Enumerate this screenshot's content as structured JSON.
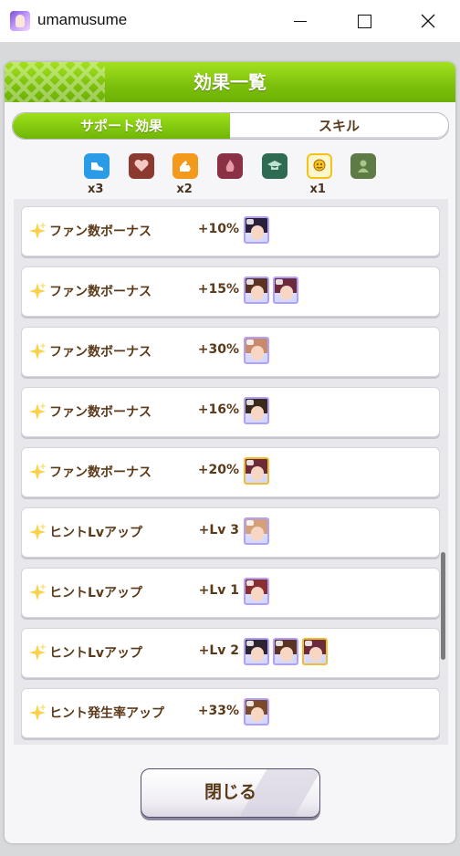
{
  "window": {
    "title": "umamusume",
    "minimize_icon": "minimize-icon",
    "maximize_icon": "maximize-icon",
    "close_icon": "close-icon"
  },
  "dialog": {
    "title": "効果一覧",
    "tabs": [
      {
        "label": "サポート効果",
        "active": true
      },
      {
        "label": "スキル",
        "active": false
      }
    ],
    "type_icons": [
      {
        "icon": "speed-shoe-icon",
        "color": "#2a9be6",
        "count": "x3"
      },
      {
        "icon": "stamina-heart-icon",
        "color": "#8c3a2f",
        "count": ""
      },
      {
        "icon": "power-arm-icon",
        "color": "#f39a1c",
        "count": "x2"
      },
      {
        "icon": "guts-flame-icon",
        "color": "#8a3146",
        "count": ""
      },
      {
        "icon": "wisdom-cap-icon",
        "color": "#2f6b52",
        "count": ""
      },
      {
        "icon": "friend-smile-icon",
        "color": "#f3c21b",
        "count": "x1"
      },
      {
        "icon": "group-icon",
        "color": "#5e7a45",
        "count": ""
      }
    ],
    "effects": [
      {
        "name": "ファン数ボーナス",
        "value": "+10%",
        "cards": [
          "purple"
        ]
      },
      {
        "name": "ファン数ボーナス",
        "value": "+15%",
        "cards": [
          "purple",
          "purple"
        ]
      },
      {
        "name": "ファン数ボーナス",
        "value": "+30%",
        "cards": [
          "purple"
        ]
      },
      {
        "name": "ファン数ボーナス",
        "value": "+16%",
        "cards": [
          "purple"
        ]
      },
      {
        "name": "ファン数ボーナス",
        "value": "+20%",
        "cards": [
          "gold"
        ]
      },
      {
        "name": "ヒントLvアップ",
        "value": "+Lv 3",
        "cards": [
          "purple"
        ]
      },
      {
        "name": "ヒントLvアップ",
        "value": "+Lv 1",
        "cards": [
          "purple"
        ]
      },
      {
        "name": "ヒントLvアップ",
        "value": "+Lv 2",
        "cards": [
          "purple",
          "purple",
          "gold"
        ]
      },
      {
        "name": "ヒント発生率アップ",
        "value": "+33%",
        "cards": [
          "purple"
        ]
      }
    ],
    "close_label": "閉じる"
  }
}
